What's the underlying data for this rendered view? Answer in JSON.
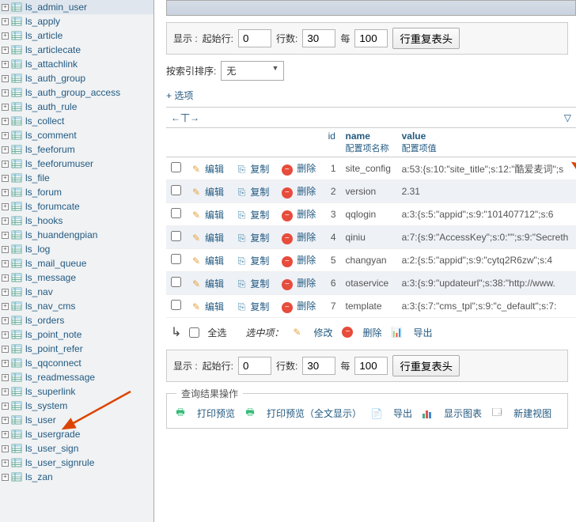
{
  "sidebar": {
    "items": [
      "ls_admin_user",
      "ls_apply",
      "ls_article",
      "ls_articlecate",
      "ls_attachlink",
      "ls_auth_group",
      "ls_auth_group_access",
      "ls_auth_rule",
      "ls_collect",
      "ls_comment",
      "ls_feeforum",
      "ls_feeforumuser",
      "ls_file",
      "ls_forum",
      "ls_forumcate",
      "ls_hooks",
      "ls_huandengpian",
      "ls_log",
      "ls_mail_queue",
      "ls_message",
      "ls_nav",
      "ls_nav_cms",
      "ls_orders",
      "ls_point_note",
      "ls_point_refer",
      "ls_qqconnect",
      "ls_readmessage",
      "ls_superlink",
      "ls_system",
      "ls_user",
      "ls_usergrade",
      "ls_user_sign",
      "ls_user_signrule",
      "ls_zan"
    ]
  },
  "pager": {
    "show": "显示 :",
    "start_row": "起始行:",
    "start_val": "0",
    "rows": "行数:",
    "rows_val": "30",
    "per": "每",
    "per_val": "100",
    "repeat_head": "行重复表头"
  },
  "sort": {
    "label": "按索引排序:",
    "value": "无"
  },
  "options": "+ 选项",
  "sort_header": {
    "arrows": "←丅→",
    "dd": "▽"
  },
  "th": {
    "id": "id",
    "name": "name",
    "name_sub": "配置项名称",
    "value": "value",
    "value_sub": "配置项值"
  },
  "actions": {
    "edit": "编辑",
    "copy": "复制",
    "delete": "删除"
  },
  "rows": [
    {
      "id": "1",
      "name": "site_config",
      "value": "a:53:{s:10:\"site_title\";s:12:\"酷爱麦词\";s"
    },
    {
      "id": "2",
      "name": "version",
      "value": "2.31"
    },
    {
      "id": "3",
      "name": "qqlogin",
      "value": "a:3:{s:5:\"appid\";s:9:\"101407712\";s:6"
    },
    {
      "id": "4",
      "name": "qiniu",
      "value": "a:7:{s:9:\"AccessKey\";s:0:\"\";s:9:\"Secreth"
    },
    {
      "id": "5",
      "name": "changyan",
      "value": "a:2:{s:5:\"appid\";s:9:\"cytq2R6zw\";s:4"
    },
    {
      "id": "6",
      "name": "otaservice",
      "value": "a:3:{s:9:\"updateurl\";s:38:\"http://www."
    },
    {
      "id": "7",
      "name": "template",
      "value": "a:3:{s:7:\"cms_tpl\";s:9:\"c_default\";s:7:"
    }
  ],
  "bottom": {
    "select_all": "全选",
    "selected": "选中项：",
    "modify": "修改",
    "delete": "删除",
    "export": "导出"
  },
  "result_ops": {
    "legend": "查询结果操作",
    "print1": "打印预览",
    "print2": "打印预览（全文显示）",
    "export": "导出",
    "chart": "显示图表",
    "newview": "新建视图"
  }
}
